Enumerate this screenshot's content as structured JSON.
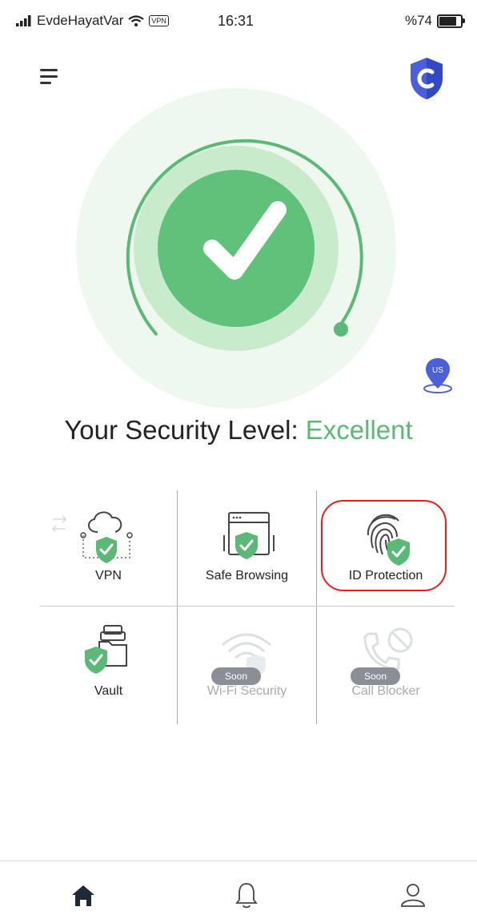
{
  "status_bar": {
    "carrier": "EvdeHayatVar",
    "vpn_badge": "VPN",
    "time": "16:31",
    "battery": "%74"
  },
  "header": {
    "menu_icon": "hamburger-menu-icon",
    "app_logo_icon": "shield-c-icon"
  },
  "gauge": {
    "status": "protected",
    "icon": "checkmark-icon",
    "colors": {
      "ring": "#5cb876",
      "inner": "#5fc17a",
      "mid": "#c8ebcc",
      "outer": "#eef8ef"
    }
  },
  "location": {
    "label": "US",
    "icon": "location-pin-icon"
  },
  "security": {
    "prefix": "Your Security Level",
    "separator": ":",
    "value": "Excellent",
    "value_color": "#5cb876"
  },
  "features": [
    {
      "label": "VPN",
      "icon": "vpn-cloud-shield-icon",
      "enabled": true
    },
    {
      "label": "Safe Browsing",
      "icon": "browser-shield-icon",
      "enabled": true
    },
    {
      "label": "ID Protection",
      "icon": "fingerprint-shield-icon",
      "enabled": true,
      "highlighted": true
    },
    {
      "label": "Vault",
      "icon": "folder-shield-icon",
      "enabled": true
    },
    {
      "label": "Wi-Fi Security",
      "icon": "wifi-shield-icon",
      "enabled": false,
      "badge": "Soon"
    },
    {
      "label": "Call Blocker",
      "icon": "phone-block-icon",
      "enabled": false,
      "badge": "Soon"
    }
  ],
  "tabbar": {
    "tabs": [
      {
        "icon": "home-icon",
        "active": true
      },
      {
        "icon": "bell-icon",
        "active": false
      },
      {
        "icon": "profile-icon",
        "active": false
      }
    ]
  },
  "colors": {
    "accent": "#5cb876",
    "brand_shield": "#4a5fd8"
  }
}
